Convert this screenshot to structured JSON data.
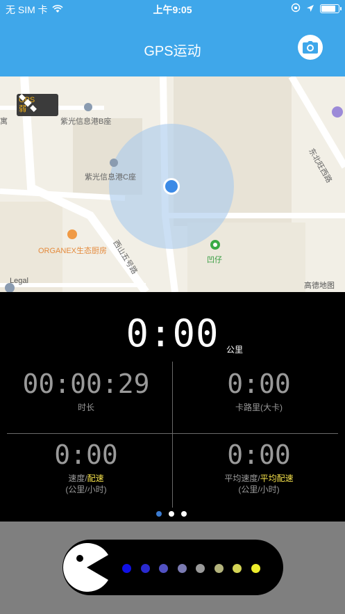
{
  "status_bar": {
    "carrier": "无 SIM 卡",
    "time": "上午9:05",
    "battery_level": 0.85
  },
  "header": {
    "title": "GPS运动",
    "camera_icon": "camera-icon"
  },
  "map": {
    "gps_badge": {
      "label": "GPS",
      "strength": "弱"
    },
    "labels": {
      "building_b": "紫光信息港B座",
      "building_c": "紫光信息港C座",
      "restaurant": "ORGANEX生态厨房",
      "road_right": "东北旺西路",
      "road_bottom": "西山五号路",
      "poi_green": "凹仔",
      "left_edge": "寓",
      "legal": "Legal",
      "brand": "高德地图"
    }
  },
  "stats": {
    "distance": {
      "value": "0:00",
      "unit": "公里"
    },
    "duration": {
      "value": "00:00:29",
      "label": "时长"
    },
    "calories": {
      "value": "0:00",
      "label": "卡路里(大卡)"
    },
    "speed": {
      "value": "0:00",
      "label_a": "速度/",
      "label_b": "配速",
      "unit": "(公里/小时)"
    },
    "avg_speed": {
      "value": "0:00",
      "label_a": "平均速度/",
      "label_b": "平均配速",
      "unit": "(公里/小时)"
    },
    "page_indicator": {
      "count": 3,
      "active_index": 0
    }
  },
  "start_slider": {
    "pellet_colors": [
      "#1010e6",
      "#2a2ad0",
      "#5151c2",
      "#7b7bb2",
      "#9a9a9a",
      "#b3b37c",
      "#d4d455",
      "#eded2b"
    ]
  }
}
